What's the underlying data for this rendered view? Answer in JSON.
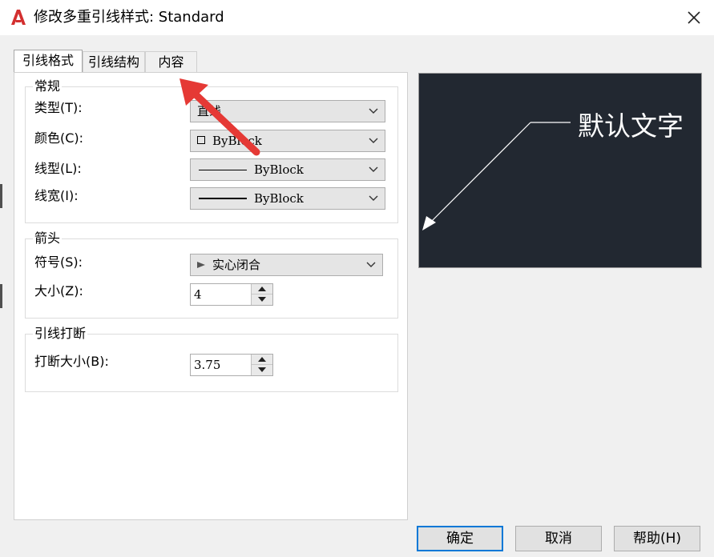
{
  "window": {
    "title": "修改多重引线样式: Standard",
    "app_icon": "autocad-a-icon",
    "icon_color": "#d32f2f"
  },
  "tabs": [
    {
      "label": "引线格式",
      "active": true
    },
    {
      "label": "引线结构",
      "active": false
    },
    {
      "label": "内容",
      "active": false
    }
  ],
  "general": {
    "title": "常规",
    "type_label": "类型(T):",
    "type_value": "直线",
    "color_label": "颜色(C):",
    "color_value": "ByBlock",
    "linetype_label": "线型(L):",
    "linetype_value": "ByBlock",
    "lineweight_label": "线宽(I):",
    "lineweight_value": "ByBlock"
  },
  "arrowhead": {
    "title": "箭头",
    "symbol_label": "符号(S):",
    "symbol_value": "实心闭合",
    "size_label": "大小(Z):",
    "size_value": "4"
  },
  "landing_break": {
    "title": "引线打断",
    "break_size_label": "打断大小(B):",
    "break_size_value": "3.75"
  },
  "preview": {
    "text": "默认文字",
    "background": "#222831"
  },
  "buttons": {
    "ok": "确定",
    "cancel": "取消",
    "help": "帮助(H)"
  },
  "annotation": {
    "arrow_color": "#e53935"
  }
}
